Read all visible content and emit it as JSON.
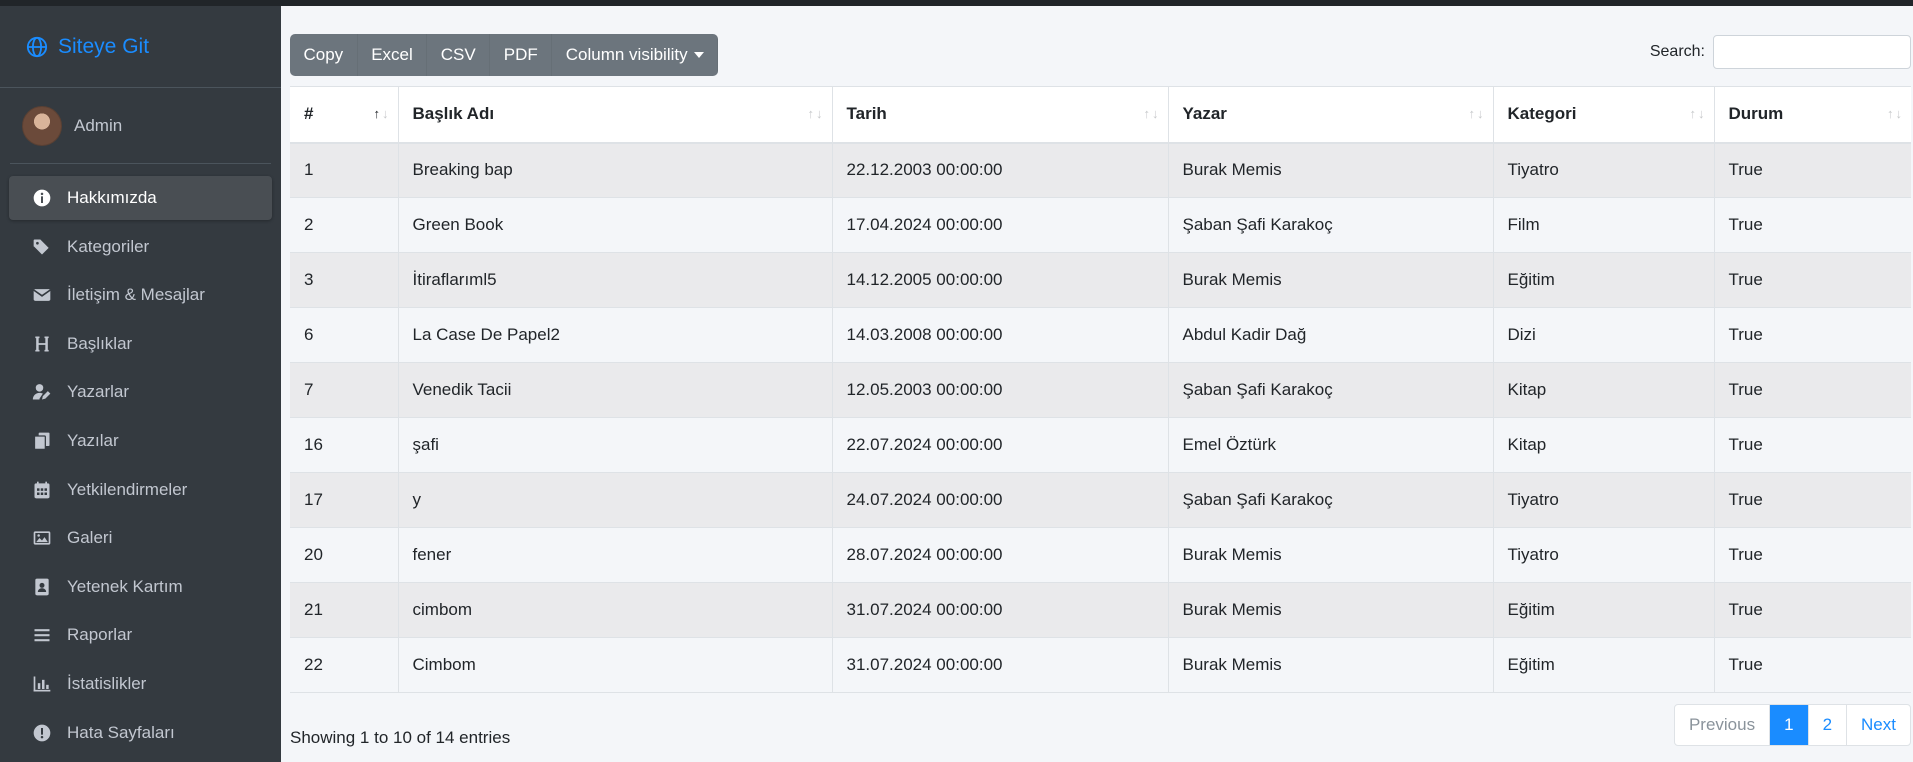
{
  "brand": {
    "label": "Siteye Git"
  },
  "user": {
    "name": "Admin"
  },
  "menu": [
    {
      "label": "Hakkımızda",
      "icon": "info-icon",
      "active": true
    },
    {
      "label": "Kategoriler",
      "icon": "tags-icon"
    },
    {
      "label": "İletişim & Mesajlar",
      "icon": "envelope-icon"
    },
    {
      "label": "Başlıklar",
      "icon": "heading-icon"
    },
    {
      "label": "Yazarlar",
      "icon": "user-edit-icon"
    },
    {
      "label": "Yazılar",
      "icon": "copy-icon"
    },
    {
      "label": "Yetkilendirmeler",
      "icon": "calendar-icon"
    },
    {
      "label": "Galeri",
      "icon": "image-icon"
    },
    {
      "label": "Yetenek Kartım",
      "icon": "id-badge-icon"
    },
    {
      "label": "Raporlar",
      "icon": "bars-icon"
    },
    {
      "label": "İstatislikler",
      "icon": "chart-bar-icon"
    },
    {
      "label": "Hata Sayfaları",
      "icon": "exclamation-circle-icon"
    }
  ],
  "toolbar": {
    "copy": "Copy",
    "excel": "Excel",
    "csv": "CSV",
    "pdf": "PDF",
    "colvis": "Column visibility"
  },
  "search": {
    "label": "Search:",
    "value": ""
  },
  "table": {
    "headers": [
      "#",
      "Başlık Adı",
      "Tarih",
      "Yazar",
      "Kategori",
      "Durum"
    ],
    "rows": [
      [
        "1",
        "Breaking bap",
        "22.12.2003 00:00:00",
        "Burak Memis",
        "Tiyatro",
        "True"
      ],
      [
        "2",
        "Green Book",
        "17.04.2024 00:00:00",
        "Şaban Şafi Karakoç",
        "Film",
        "True"
      ],
      [
        "3",
        "İtiraflarıml5",
        "14.12.2005 00:00:00",
        "Burak Memis",
        "Eğitim",
        "True"
      ],
      [
        "6",
        "La Case De Papel2",
        "14.03.2008 00:00:00",
        "Abdul Kadir Dağ",
        "Dizi",
        "True"
      ],
      [
        "7",
        "Venedik Tacii",
        "12.05.2003 00:00:00",
        "Şaban Şafi Karakoç",
        "Kitap",
        "True"
      ],
      [
        "16",
        "şafi",
        "22.07.2024 00:00:00",
        "Emel Öztürk",
        "Kitap",
        "True"
      ],
      [
        "17",
        "y",
        "24.07.2024 00:00:00",
        "Şaban Şafi Karakoç",
        "Tiyatro",
        "True"
      ],
      [
        "20",
        "fener",
        "28.07.2024 00:00:00",
        "Burak Memis",
        "Tiyatro",
        "True"
      ],
      [
        "21",
        "cimbom",
        "31.07.2024 00:00:00",
        "Burak Memis",
        "Eğitim",
        "True"
      ],
      [
        "22",
        "Cimbom",
        "31.07.2024 00:00:00",
        "Burak Memis",
        "Eğitim",
        "True"
      ]
    ]
  },
  "footer": {
    "info": "Showing 1 to 10 of 14 entries",
    "previous": "Previous",
    "pages": [
      "1",
      "2"
    ],
    "next": "Next"
  },
  "colors": {
    "accent": "#1a8cff",
    "sidebar": "#343a40",
    "button": "#6c757d"
  }
}
